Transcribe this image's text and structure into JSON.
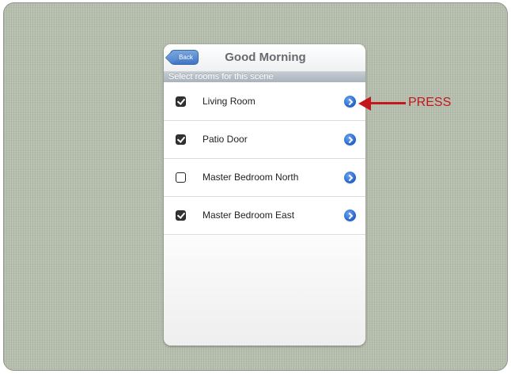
{
  "navbar": {
    "back_label": "Back",
    "title": "Good Morning"
  },
  "section_header": "Select rooms for this scene",
  "rooms": [
    {
      "label": "Living Room",
      "checked": true
    },
    {
      "label": "Patio Door",
      "checked": true
    },
    {
      "label": "Master Bedroom North",
      "checked": false
    },
    {
      "label": "Master Bedroom East",
      "checked": true
    }
  ],
  "annotation": {
    "label": "PRESS",
    "color": "#c4161c"
  },
  "colors": {
    "accent": "#3f74c6",
    "background": "#b6bfae"
  }
}
